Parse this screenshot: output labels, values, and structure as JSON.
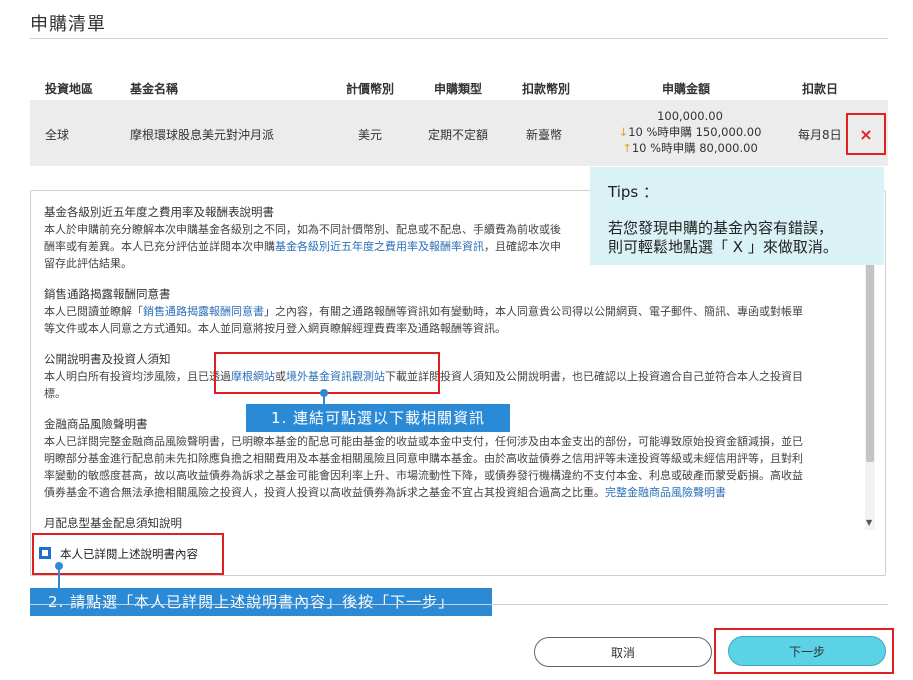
{
  "page_title": "申購清單",
  "table": {
    "headers": [
      "投資地區",
      "基金名稱",
      "計價幣別",
      "申購類型",
      "扣款幣別",
      "申購金額",
      "扣款日"
    ],
    "row": {
      "region": "全球",
      "fund_name": "摩根環球股息美元對沖月派",
      "currency": "美元",
      "type": "定期不定額",
      "debit_currency": "新臺幣",
      "amount": "100,000.00",
      "amount_down": "10 %時申購 150,000.00",
      "amount_up": "10 %時申購 80,000.00",
      "debit_day": "每月8日",
      "delete_label": "×"
    }
  },
  "tips": {
    "title": "Tips ：",
    "line1": "若您發現申購的基金內容有錯誤，",
    "line2": "則可輕鬆地點選「 X 」來做取消。"
  },
  "doc": {
    "s1_title": "基金各級別近五年度之費用率及報酬表說明書",
    "s1_a": "本人於申購前充分瞭解本次申購基金各級別之不同，如為不同計價幣別、配息或不配息、手續費為前收或後",
    "s1_b": "酬率或有差異。本人已充分評估並詳閱本次申購",
    "s1_link": "基金各級別近五年度之費用率及報酬率資訊",
    "s1_c": "，且確認本次申",
    "s1_d": "留存此評估結果。",
    "s2_title": "銷售通路揭露報酬同意書",
    "s2_a": "本人已閱讀並瞭解「",
    "s2_link": "銷售通路揭露報酬同意書",
    "s2_b": "」之內容，有關之通路報酬等資訊如有變動時，本人同意貴公司得以公開網頁、電子郵件、簡訊、專函或對帳單",
    "s2_c": "等文件或本人同意之方式通知。本人並同意將按月登入網頁瞭解經理費費率及通路報酬等資訊。",
    "s3_title": "公開說明書及投資人須知",
    "s3_a": "本人明白所有投資均涉風險，且已透過",
    "s3_link1": "摩根網站",
    "s3_or": "或",
    "s3_link2": "境外基金資訊觀測站",
    "s3_b": "下載並詳閱投資人須知及公開說明書，也已確認以上投資適合自己並符合本人之投資目",
    "s3_c": "標。",
    "s4_title": "金融商品風險聲明書",
    "s4_a": "本人已詳閱完整金融商品風險聲明書，已明瞭本基金的配息可能由基金的收益或本金中支付，任何涉及由本金支出的部份，可能導致原始投資金額減損，並已",
    "s4_b": "明瞭部分基金進行配息前未先扣除應負擔之相關費用及本基金相關風險且同意申購本基金。由於高收益債券之信用評等未達投資等級或未經信用評等，且對利",
    "s4_c": "率變動的敏感度甚高，故以高收益債券為訴求之基金可能會因利率上升、市場流動性下降，或債券發行機構違約不支付本金、利息或破產而蒙受虧損。高收益",
    "s4_d": "債券基金不適合無法承擔相關風險之投資人，投資人投資以高收益債券為訴求之基金不宜占其投資組合過高之比重。",
    "s4_link": "完整金融商品風險聲明書",
    "s5_title": "月配息型基金配息須知說明"
  },
  "checkbox_label": "本人已詳閱上述說明書內容",
  "callout1": "1. 連結可點選以下載相關資訊",
  "callout2": "2. 請點選「本人已詳閱上述說明書內容」後按「下一步」",
  "buttons": {
    "cancel": "取消",
    "next": "下一步"
  },
  "colors": {
    "accent": "#5bd2e6",
    "highlight_red": "#e02020",
    "callout_blue": "#2b8ad6",
    "tips_bg": "#daf1f6"
  }
}
